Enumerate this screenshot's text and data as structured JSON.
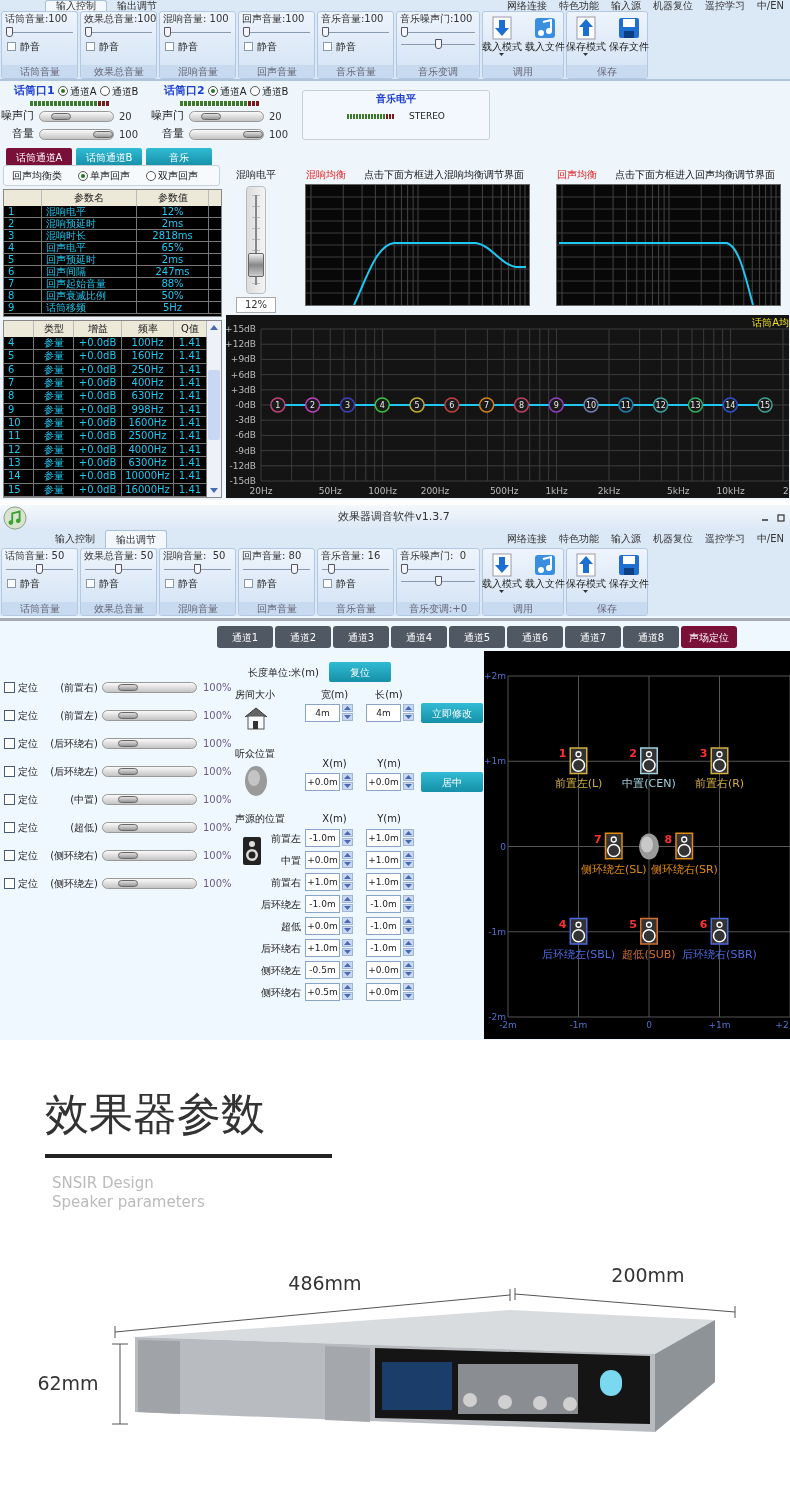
{
  "screen_1": {
    "tabs": [
      {
        "label": "输入控制",
        "selected": true
      },
      {
        "label": "输出调节",
        "selected": false
      }
    ],
    "menu": [
      "网络连接",
      "特色功能",
      "输入源",
      "机器复位",
      "遥控学习",
      "中/EN"
    ],
    "ribbon": {
      "groups": [
        {
          "kind": "sliders",
          "title": "话筒音量:100",
          "sliders": [
            {
              "level": 0
            }
          ],
          "mute": {
            "label": "静音",
            "checked": false
          },
          "footer": "话筒音量"
        },
        {
          "kind": "sliders",
          "title": "效果总音量:100",
          "sliders": [
            {
              "level": 0
            }
          ],
          "mute": {
            "label": "静音",
            "checked": false
          },
          "footer": "效果总音量"
        },
        {
          "kind": "sliders",
          "title": "混响音量: 100",
          "sliders": [
            {
              "level": 0
            }
          ],
          "mute": {
            "label": "静音",
            "checked": false
          },
          "footer": "混响音量"
        },
        {
          "kind": "sliders",
          "title": "回声音量:100",
          "sliders": [
            {
              "level": 0
            }
          ],
          "mute": {
            "label": "静音",
            "checked": false
          },
          "footer": "回声音量"
        },
        {
          "kind": "sliders",
          "title": "音乐音量:100",
          "sliders": [
            {
              "level": 0
            }
          ],
          "mute": {
            "label": "静音",
            "checked": false
          },
          "footer": "音乐音量"
        },
        {
          "kind": "sliders",
          "title": "音乐噪声门:100",
          "sliders": [
            {
              "level": 0
            },
            {
              "level": 0.5
            }
          ],
          "footer": "音乐变调"
        },
        {
          "kind": "load",
          "buttons": [
            "载入模式",
            "载入文件"
          ],
          "footer": "调用"
        },
        {
          "kind": "save",
          "buttons": [
            "保存模式",
            "保存文件"
          ],
          "footer": "保存"
        }
      ]
    },
    "mic_inputs": [
      {
        "title": "话筒口1",
        "channels": [
          {
            "label": "通道A",
            "selected": true
          },
          {
            "label": "通道B",
            "selected": false
          }
        ],
        "controls": [
          {
            "label": "噪声门",
            "level": 0.2,
            "value": "20"
          },
          {
            "label": "音量",
            "level": 1,
            "value": "100"
          }
        ]
      },
      {
        "title": "话筒口2",
        "channels": [
          {
            "label": "通道A",
            "selected": true
          },
          {
            "label": "通道B",
            "selected": false
          }
        ],
        "controls": [
          {
            "label": "噪声门",
            "level": 0.2,
            "value": "20"
          },
          {
            "label": "音量",
            "level": 1,
            "value": "100"
          }
        ]
      }
    ],
    "music_level": {
      "title": "音乐电平",
      "mode": "STEREO"
    },
    "source_tabs": [
      {
        "label": "话筒通道A",
        "selected": true
      },
      {
        "label": "话筒通道B",
        "selected": false
      },
      {
        "label": "音乐",
        "selected": false
      }
    ],
    "echo_type": {
      "label": "回声均衡类",
      "options": [
        {
          "label": "单声回声",
          "selected": true
        },
        {
          "label": "双声回声",
          "selected": false
        }
      ]
    },
    "parameter_table": {
      "columns": [
        "",
        "参数名",
        "参数值"
      ],
      "rows": [
        [
          "1",
          "混响电平",
          "12%"
        ],
        [
          "2",
          "混响预延时",
          "2ms"
        ],
        [
          "3",
          "混响时长",
          "2818ms"
        ],
        [
          "4",
          "回声电平",
          "65%"
        ],
        [
          "5",
          "回声预延时",
          "2ms"
        ],
        [
          "6",
          "回声间隔",
          "247ms"
        ],
        [
          "7",
          "回声起始音量",
          "88%"
        ],
        [
          "8",
          "回声衰减比例",
          "50%"
        ],
        [
          "9",
          "话筒移频",
          "5Hz"
        ]
      ]
    },
    "reverb_fader": {
      "title": "混响电平",
      "level": 0.2,
      "value": "12%"
    },
    "eq_panels": [
      {
        "kind": "rise-fall",
        "title": "混响均衡",
        "hint": "点击下面方框进入混响均衡调节界面"
      },
      {
        "kind": "fall",
        "title": "回声均衡",
        "hint": "点击下面方框进入回声均衡调节界面"
      }
    ],
    "eq_table": {
      "columns": [
        "",
        "类型",
        "增益",
        "频率",
        "Q值"
      ],
      "rows": [
        [
          "4",
          "参量",
          "+0.0dB",
          "100Hz",
          "1.41"
        ],
        [
          "5",
          "参量",
          "+0.0dB",
          "160Hz",
          "1.41"
        ],
        [
          "6",
          "参量",
          "+0.0dB",
          "250Hz",
          "1.41"
        ],
        [
          "7",
          "参量",
          "+0.0dB",
          "400Hz",
          "1.41"
        ],
        [
          "8",
          "参量",
          "+0.0dB",
          "630Hz",
          "1.41"
        ],
        [
          "9",
          "参量",
          "+0.0dB",
          "998Hz",
          "1.41"
        ],
        [
          "10",
          "参量",
          "+0.0dB",
          "1600Hz",
          "1.41"
        ],
        [
          "11",
          "参量",
          "+0.0dB",
          "2500Hz",
          "1.41"
        ],
        [
          "12",
          "参量",
          "+0.0dB",
          "4000Hz",
          "1.41"
        ],
        [
          "13",
          "参量",
          "+0.0dB",
          "6300Hz",
          "1.41"
        ],
        [
          "14",
          "参量",
          "+0.0dB",
          "10000Hz",
          "1.41"
        ],
        [
          "15",
          "参量",
          "+0.0dB",
          "16000Hz",
          "1.41"
        ]
      ]
    },
    "eq_chart": {
      "frequency_labels": [
        "20Hz",
        "50Hz",
        "100Hz",
        "200Hz",
        "500Hz",
        "1kHz",
        "2kHz",
        "5kHz",
        "10kHz",
        "2"
      ],
      "markers": [
        {
          "label": "1",
          "color": "#c0407a"
        },
        {
          "label": "2",
          "color": "#c040c0"
        },
        {
          "label": "3",
          "color": "#4040c0"
        },
        {
          "label": "4",
          "color": "#40c040"
        },
        {
          "label": "5",
          "color": "#c0b030"
        },
        {
          "label": "6",
          "color": "#c04040"
        },
        {
          "label": "7",
          "color": "#d08020"
        },
        {
          "label": "8",
          "color": "#c04060"
        },
        {
          "label": "9",
          "color": "#9040c0"
        },
        {
          "label": "10",
          "color": "#7080b0"
        },
        {
          "label": "11",
          "color": "#2080b0"
        },
        {
          "label": "12",
          "color": "#40a0a0"
        },
        {
          "label": "13",
          "color": "#30b060"
        },
        {
          "label": "14",
          "color": "#3050d0"
        },
        {
          "label": "15",
          "color": "#40a090"
        }
      ],
      "chart_data": {
        "type": "line",
        "grid": true,
        "x": [
          1,
          2,
          3,
          4,
          5,
          6,
          7,
          8,
          9,
          10,
          11,
          12,
          13,
          14,
          15
        ],
        "ylim": [
          -15,
          15
        ],
        "series": [
          {
            "name": "话筒A均",
            "color": "#1ec8f0",
            "marker": "circle",
            "values": [
              0,
              0,
              0,
              0,
              0,
              0,
              0,
              0,
              0,
              0,
              0,
              0,
              0,
              0,
              0
            ]
          }
        ],
        "yticks": [
          {
            "value": 15,
            "label": "+15dB"
          },
          {
            "value": 12,
            "label": "+12dB"
          },
          {
            "value": 9,
            "label": "+9dB"
          },
          {
            "value": 6,
            "label": "+6dB"
          },
          {
            "value": 3,
            "label": "+3dB"
          },
          {
            "value": 0,
            "label": "-0dB"
          },
          {
            "value": -3,
            "label": "-3dB"
          },
          {
            "value": -6,
            "label": "-6dB"
          },
          {
            "value": -9,
            "label": "-9dB"
          },
          {
            "value": -12,
            "label": "-12dB"
          },
          {
            "value": -15,
            "label": "-15dB"
          }
        ]
      }
    }
  },
  "screen_2": {
    "window": {
      "title": "效果器调音软件v1.3.7"
    },
    "tabs": [
      {
        "label": "输入控制",
        "selected": false
      },
      {
        "label": "输出调节",
        "selected": true
      }
    ],
    "menu": [
      "网络连接",
      "特色功能",
      "输入源",
      "机器复位",
      "遥控学习",
      "中/EN"
    ],
    "ribbon": {
      "groups": [
        {
          "kind": "sliders",
          "title": "话筒音量: 50",
          "sliders": [
            {
              "level": 0.5
            }
          ],
          "mute": {
            "label": "静音",
            "checked": false
          },
          "footer": "话筒音量"
        },
        {
          "kind": "sliders",
          "title": "效果总音量: 50",
          "sliders": [
            {
              "level": 0.5
            }
          ],
          "mute": {
            "label": "静音",
            "checked": false
          },
          "footer": "效果总音量"
        },
        {
          "kind": "sliders",
          "title": "混响音量:  50",
          "sliders": [
            {
              "level": 0.5
            }
          ],
          "mute": {
            "label": "静音",
            "checked": false
          },
          "footer": "混响音量"
        },
        {
          "kind": "sliders",
          "title": "回声音量: 80",
          "sliders": [
            {
              "level": 0.8
            }
          ],
          "mute": {
            "label": "静音",
            "checked": false
          },
          "footer": "回声音量"
        },
        {
          "kind": "sliders",
          "title": "音乐音量: 16",
          "sliders": [
            {
              "level": 0.1
            }
          ],
          "mute": {
            "label": "静音",
            "checked": false
          },
          "footer": "音乐音量"
        },
        {
          "kind": "sliders",
          "title": "音乐噪声门:  0",
          "sliders": [
            {
              "level": 0
            },
            {
              "level": 0.5
            }
          ],
          "footer": "音乐变调:+0"
        },
        {
          "kind": "load",
          "buttons": [
            "载入模式",
            "载入文件"
          ],
          "footer": "调用"
        },
        {
          "kind": "save",
          "buttons": [
            "保存模式",
            "保存文件"
          ],
          "footer": "保存"
        }
      ]
    },
    "channel_tabs": [
      {
        "label": "通道1",
        "selected": false
      },
      {
        "label": "通道2",
        "selected": false
      },
      {
        "label": "通道3",
        "selected": false
      },
      {
        "label": "通道4",
        "selected": false
      },
      {
        "label": "通道5",
        "selected": false
      },
      {
        "label": "通道6",
        "selected": false
      },
      {
        "label": "通道7",
        "selected": false
      },
      {
        "label": "通道8",
        "selected": false
      },
      {
        "label": "声场定位",
        "selected": true
      }
    ],
    "positioning": [
      {
        "checkbox": {
          "label": "定位",
          "checked": false
        },
        "name": "(前置右)",
        "level": 0.2,
        "value": "100%"
      },
      {
        "checkbox": {
          "label": "定位",
          "checked": false
        },
        "name": "(前置左)",
        "level": 0.2,
        "value": "100%"
      },
      {
        "checkbox": {
          "label": "定位",
          "checked": false
        },
        "name": "(后环绕右)",
        "level": 0.2,
        "value": "100%"
      },
      {
        "checkbox": {
          "label": "定位",
          "checked": false
        },
        "name": "(后环绕左)",
        "level": 0.2,
        "value": "100%"
      },
      {
        "checkbox": {
          "label": "定位",
          "checked": false
        },
        "name": "(中置)",
        "level": 0.2,
        "value": "100%"
      },
      {
        "checkbox": {
          "label": "定位",
          "checked": false
        },
        "name": "(超低)",
        "level": 0.2,
        "value": "100%"
      },
      {
        "checkbox": {
          "label": "定位",
          "checked": false
        },
        "name": "(侧环绕右)",
        "level": 0.2,
        "value": "100%"
      },
      {
        "checkbox": {
          "label": "定位",
          "checked": false
        },
        "name": "(侧环绕左)",
        "level": 0.2,
        "value": "100%"
      }
    ],
    "unit": {
      "label": "长度单位:米(m)",
      "button": "复位"
    },
    "room_size": {
      "label": "房间大小",
      "width_label": "宽(m)",
      "width": "4m",
      "length_label": "长(m)",
      "length": "4m",
      "button": "立即修改"
    },
    "listener": {
      "label": "听众位置",
      "x_label": "X(m)",
      "x": "+0.0m",
      "y_label": "Y(m)",
      "y": "+0.0m",
      "button": "居中"
    },
    "sources": {
      "label": "声源的位置",
      "x_label": "X(m)",
      "y_label": "Y(m)",
      "rows": [
        {
          "name": "前置左",
          "x": "-1.0m",
          "y": "+1.0m"
        },
        {
          "name": "中置",
          "x": "+0.0m",
          "y": "+1.0m"
        },
        {
          "name": "前置右",
          "x": "+1.0m",
          "y": "+1.0m"
        },
        {
          "name": "后环绕左",
          "x": "-1.0m",
          "y": "-1.0m"
        },
        {
          "name": "超低",
          "x": "+0.0m",
          "y": "-1.0m"
        },
        {
          "name": "后环绕右",
          "x": "+1.0m",
          "y": "-1.0m"
        },
        {
          "name": "侧环绕左",
          "x": "-0.5m",
          "y": "+0.0m"
        },
        {
          "name": "侧环绕右",
          "x": "+0.5m",
          "y": "+0.0m"
        }
      ]
    },
    "sound_field": {
      "chart_data": {
        "type": "scatter",
        "grid": true,
        "xlim": [
          -2,
          2
        ],
        "ylim": [
          -2,
          2
        ],
        "xticks": [
          {
            "value": -2,
            "label": "-2m"
          },
          {
            "value": -1,
            "label": "-1m"
          },
          {
            "value": 0,
            "label": "0"
          },
          {
            "value": 1,
            "label": "+1m"
          },
          {
            "value": 2,
            "label": "+2"
          }
        ],
        "yticks": [
          {
            "value": 2,
            "label": "+2m"
          },
          {
            "value": 1,
            "label": "+1m"
          },
          {
            "value": 0,
            "label": "0"
          },
          {
            "value": -1,
            "label": "-1m"
          },
          {
            "value": -2,
            "label": "-2m"
          }
        ],
        "series": [
          {
            "name": "前置左(L)",
            "marker": "square",
            "color": "#d4b040",
            "x": [
              -1
            ],
            "values": [
              1
            ]
          },
          {
            "name": "中置(CEN)",
            "marker": "square",
            "color": "#a0d0e0",
            "x": [
              0
            ],
            "values": [
              1
            ]
          },
          {
            "name": "前置右(R)",
            "marker": "square",
            "color": "#d4b040",
            "x": [
              1
            ],
            "values": [
              1
            ]
          },
          {
            "name": "后环绕左(SBL)",
            "marker": "square",
            "color": "#4a6ae0",
            "x": [
              -1
            ],
            "values": [
              -1
            ]
          },
          {
            "name": "超低(SUB)",
            "marker": "square",
            "color": "#d07030",
            "x": [
              0
            ],
            "values": [
              -1
            ]
          },
          {
            "name": "后环绕右(SBR)",
            "marker": "square",
            "color": "#4a6ae0",
            "x": [
              1
            ],
            "values": [
              -1
            ]
          },
          {
            "name": "侧环绕左(SL)",
            "marker": "square",
            "color": "#e08a10",
            "x": [
              -0.5
            ],
            "values": [
              0
            ]
          },
          {
            "name": "侧环绕右(SR)",
            "marker": "square",
            "color": "#e08a10",
            "x": [
              0.5
            ],
            "values": [
              0
            ]
          }
        ]
      },
      "speaker_numbers": [
        "1",
        "2",
        "3",
        "4",
        "5",
        "6",
        "7",
        "8"
      ]
    }
  },
  "promo": {
    "heading": "效果器参数",
    "subtitle": "SNSIR Design",
    "caption": "Speaker parameters",
    "dimensions": {
      "width": "486mm",
      "depth": "200mm",
      "height": "62mm"
    }
  }
}
